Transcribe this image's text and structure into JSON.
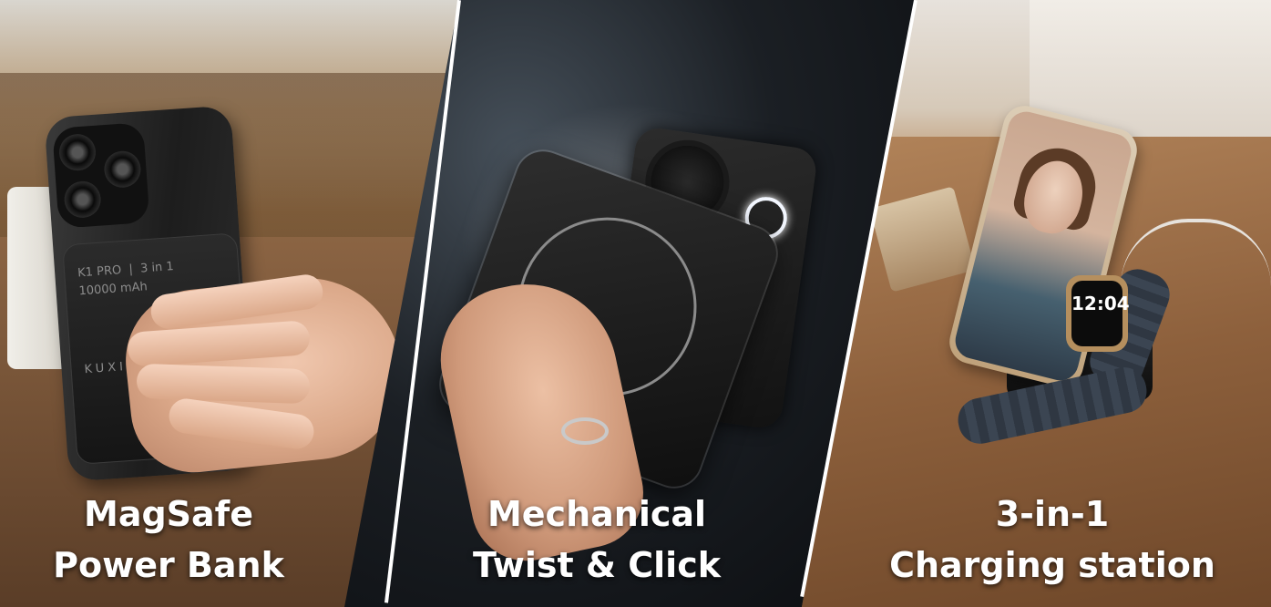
{
  "panels": [
    {
      "caption_line1": "MagSafe",
      "caption_line2": "Power Bank",
      "product_text": {
        "model": "K1 PRO",
        "variant": "3 in 1",
        "capacity": "10000 mAh",
        "brand": "KUXIU"
      }
    },
    {
      "caption_line1": "Mechanical",
      "caption_line2": "Twist & Click"
    },
    {
      "caption_line1": "3-in-1",
      "caption_line2": "Charging station",
      "watch_time": "12:04"
    }
  ]
}
